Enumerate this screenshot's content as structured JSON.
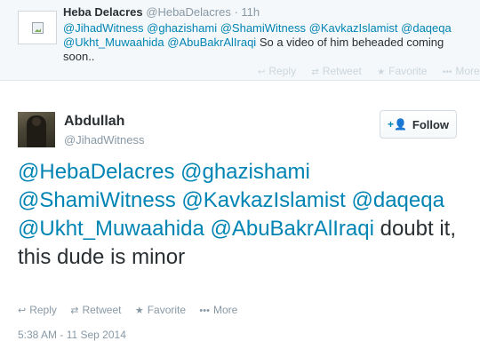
{
  "reply_context": {
    "author_name": "Heba Delacres",
    "author_handle": "@HebaDelacres",
    "separator": "·",
    "time": "11h",
    "avatar_icon": "broken-image-icon",
    "mentions": [
      "@JihadWitness",
      "@ghazishami",
      "@ShamiWitness",
      "@KavkazIslamist",
      "@daqeqa",
      "@Ukht_Muwaahida",
      "@AbuBakrAlIraqi"
    ],
    "text": "So a video of him beheaded coming soon..",
    "actions": [
      {
        "icon": "reply-icon",
        "label": "Reply"
      },
      {
        "icon": "retweet-icon",
        "label": "Retweet"
      },
      {
        "icon": "favorite-icon",
        "label": "Favorite"
      },
      {
        "icon": "more-icon",
        "label": "More"
      }
    ]
  },
  "tweet": {
    "author_name": "Abdullah",
    "author_handle": "@JihadWitness",
    "follow_button": {
      "icon": "add-user-icon",
      "label": "Follow"
    },
    "mentions": [
      "@HebaDelacres",
      "@ghazishami",
      "@ShamiWitness",
      "@KavkazIslamist",
      "@daqeqa",
      "@Ukht_Muwaahida",
      "@AbuBakrAlIraqi"
    ],
    "text": "doubt it, this dude is minor",
    "actions": [
      {
        "icon": "reply-icon",
        "label": "Reply"
      },
      {
        "icon": "retweet-icon",
        "label": "Retweet"
      },
      {
        "icon": "favorite-icon",
        "label": "Favorite"
      },
      {
        "icon": "more-icon",
        "label": "More"
      }
    ],
    "timestamp": "5:38 AM - 11 Sep 2014"
  },
  "colors": {
    "link": "#0084b4",
    "muted": "#8899a6",
    "context_background": "#f5f8fa",
    "text": "#292f33"
  }
}
